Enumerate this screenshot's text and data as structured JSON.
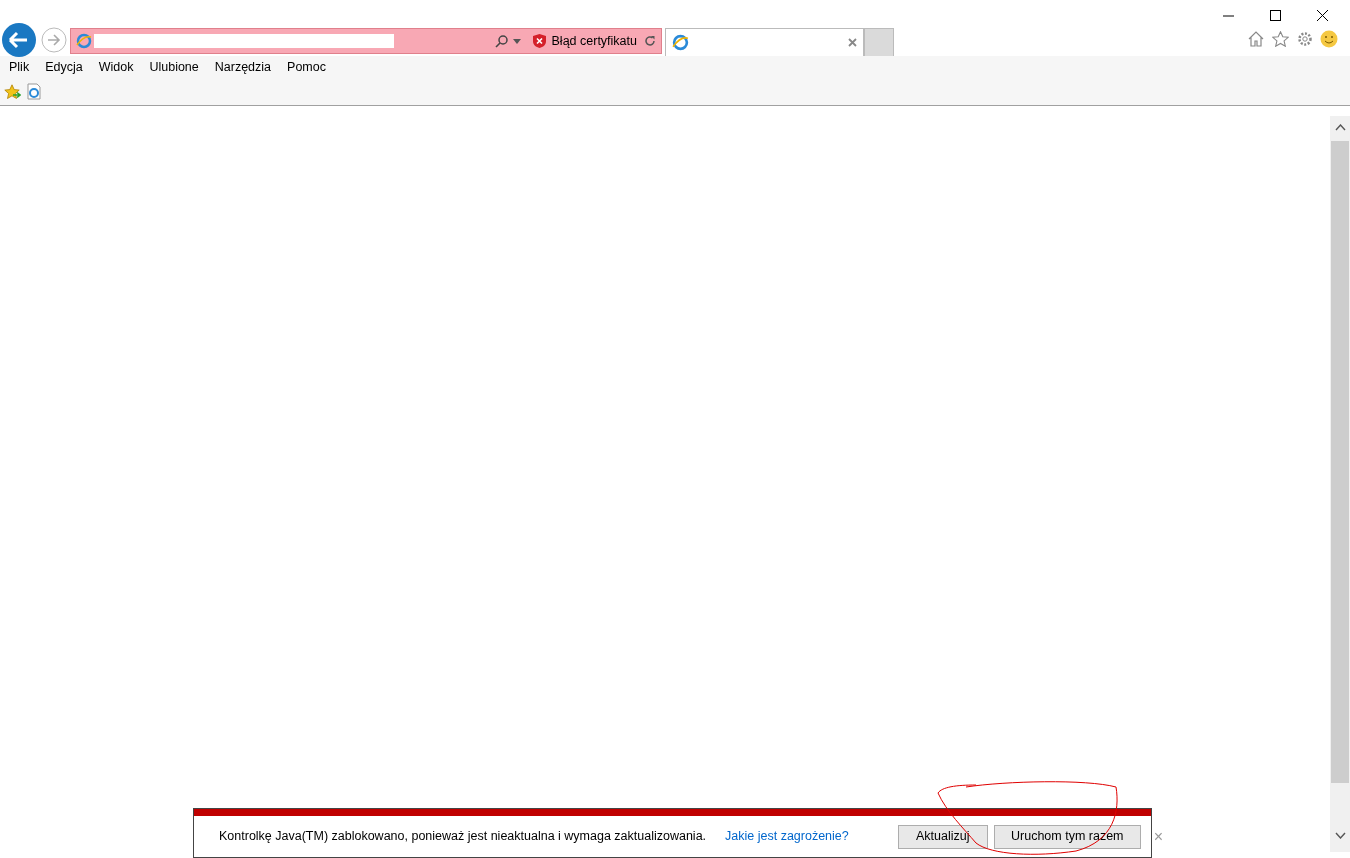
{
  "address_bar": {
    "certificate_error": "Błąd certyfikatu"
  },
  "menu": [
    {
      "label": "Plik"
    },
    {
      "label": "Edycja"
    },
    {
      "label": "Widok"
    },
    {
      "label": "Ulubione"
    },
    {
      "label": "Narzędzia"
    },
    {
      "label": "Pomoc"
    }
  ],
  "notification": {
    "message": "Kontrolkę Java(TM) zablokowano, ponieważ jest nieaktualna i wymaga zaktualizowania.",
    "link": "Jakie jest zagrożenie?",
    "buttons": [
      {
        "label": "Aktualizuj"
      },
      {
        "label": "Uruchom tym razem"
      }
    ],
    "close": "×"
  }
}
